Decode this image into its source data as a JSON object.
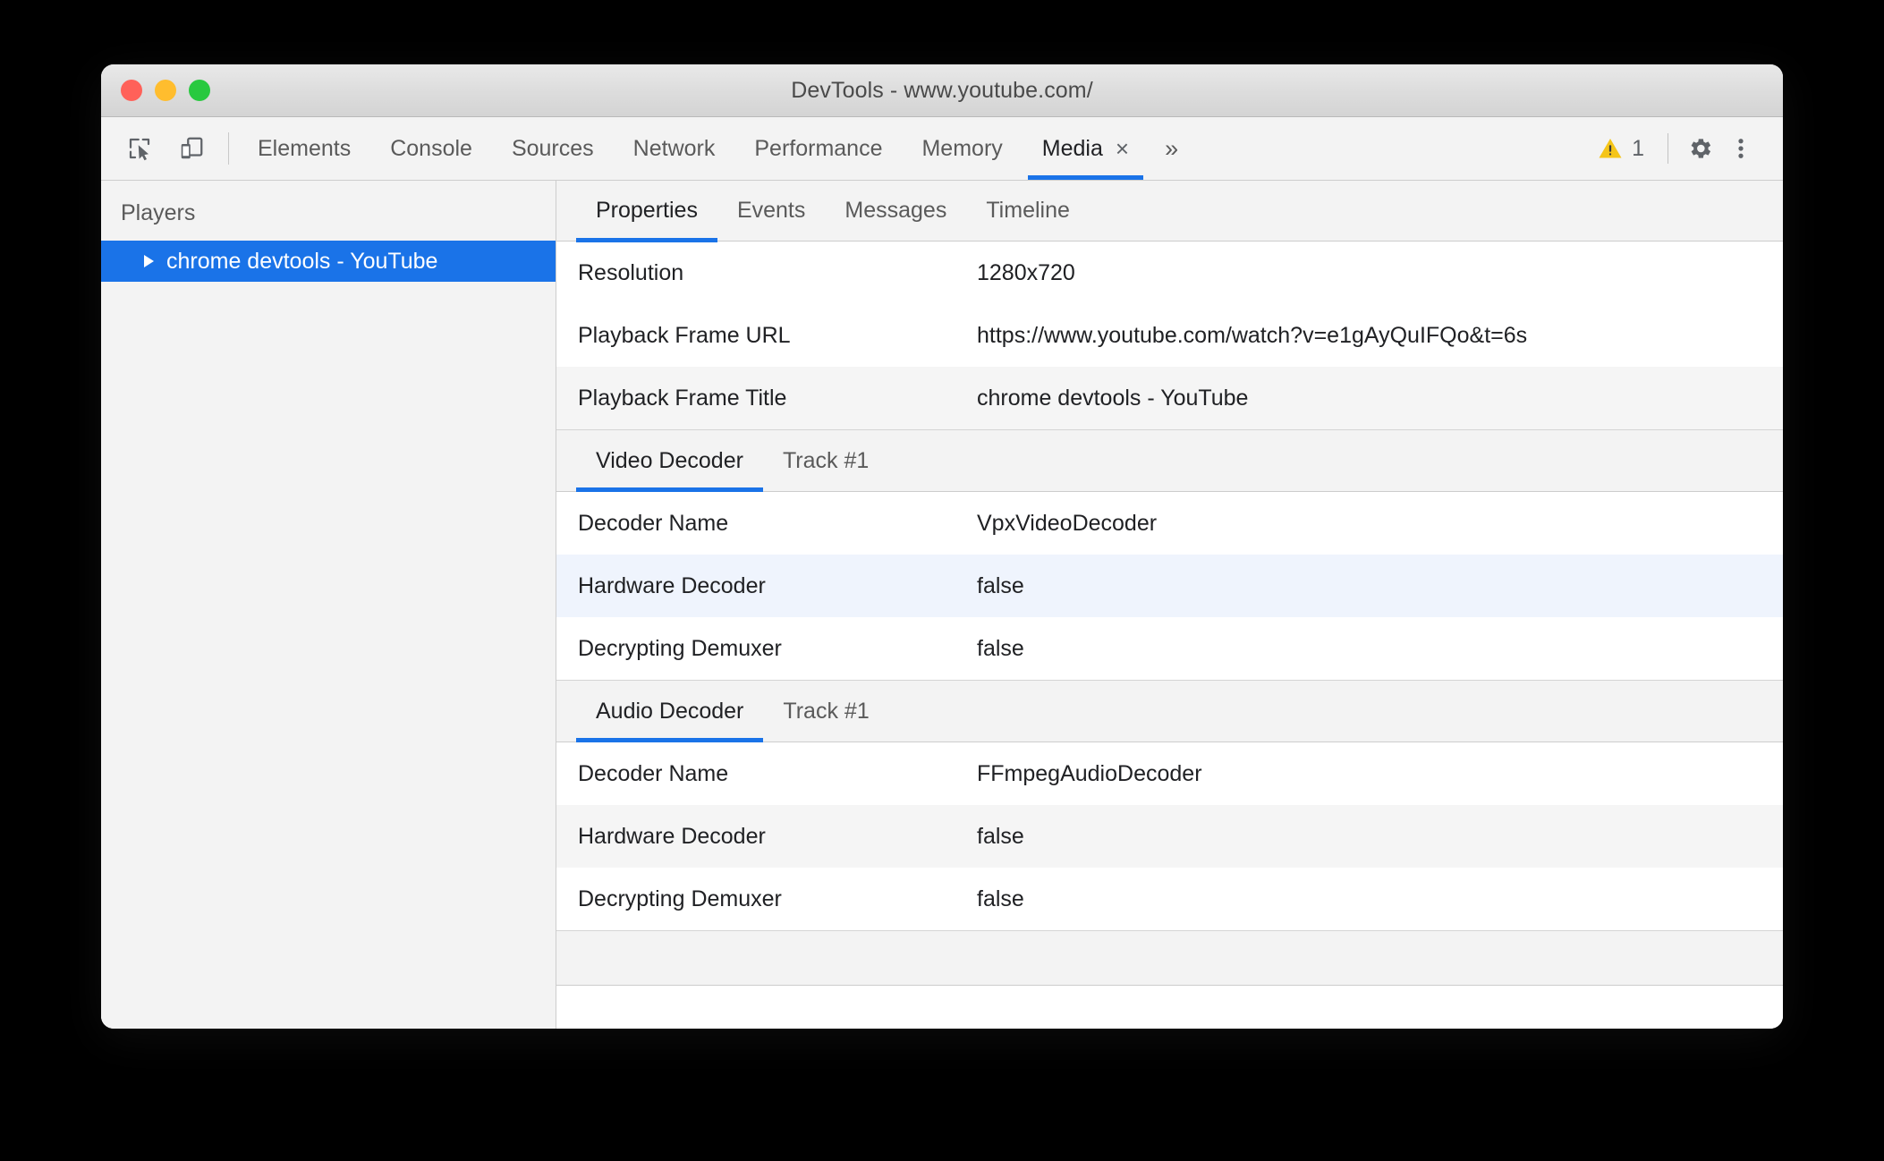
{
  "window": {
    "title": "DevTools - www.youtube.com/",
    "traffic_lights": [
      "close",
      "minimize",
      "maximize"
    ]
  },
  "toolbar": {
    "left_icons": [
      {
        "name": "inspect-element-icon",
        "label": "Inspect element"
      },
      {
        "name": "device-toolbar-icon",
        "label": "Toggle device toolbar"
      }
    ],
    "tabs": [
      {
        "label": "Elements",
        "active": false
      },
      {
        "label": "Console",
        "active": false
      },
      {
        "label": "Sources",
        "active": false
      },
      {
        "label": "Network",
        "active": false
      },
      {
        "label": "Performance",
        "active": false
      },
      {
        "label": "Memory",
        "active": false
      },
      {
        "label": "Media",
        "active": true,
        "closable": true
      }
    ],
    "tab_close_glyph": "×",
    "more_tabs_glyph": "»",
    "warning_count": "1",
    "warning_color": "#f5c518",
    "accent_color": "#1a73e8",
    "settings_label": "Settings",
    "menu_label": "Customize and control DevTools"
  },
  "sidebar": {
    "title": "Players",
    "players": [
      {
        "label": "chrome devtools - YouTube",
        "selected": true,
        "expanded": false
      }
    ]
  },
  "content": {
    "subtabs": [
      {
        "label": "Properties",
        "active": true
      },
      {
        "label": "Events",
        "active": false
      },
      {
        "label": "Messages",
        "active": false
      },
      {
        "label": "Timeline",
        "active": false
      }
    ],
    "top_properties": [
      {
        "name": "Resolution",
        "value": "1280x720",
        "stripe": "white"
      },
      {
        "name": "Playback Frame URL",
        "value": "https://www.youtube.com/watch?v=e1gAyQuIFQo&t=6s",
        "stripe": "white"
      },
      {
        "name": "Playback Frame Title",
        "value": "chrome devtools - YouTube",
        "stripe": "gray"
      }
    ],
    "sections": [
      {
        "tabs": [
          {
            "label": "Video Decoder",
            "active": true
          },
          {
            "label": "Track #1",
            "active": false
          }
        ],
        "rows": [
          {
            "name": "Decoder Name",
            "value": "VpxVideoDecoder",
            "stripe": "white"
          },
          {
            "name": "Hardware Decoder",
            "value": "false",
            "stripe": "blue"
          },
          {
            "name": "Decrypting Demuxer",
            "value": "false",
            "stripe": "white"
          }
        ]
      },
      {
        "tabs": [
          {
            "label": "Audio Decoder",
            "active": true
          },
          {
            "label": "Track #1",
            "active": false
          }
        ],
        "rows": [
          {
            "name": "Decoder Name",
            "value": "FFmpegAudioDecoder",
            "stripe": "white"
          },
          {
            "name": "Hardware Decoder",
            "value": "false",
            "stripe": "gray"
          },
          {
            "name": "Decrypting Demuxer",
            "value": "false",
            "stripe": "white"
          }
        ]
      },
      {
        "tabs": [],
        "rows": []
      }
    ]
  }
}
